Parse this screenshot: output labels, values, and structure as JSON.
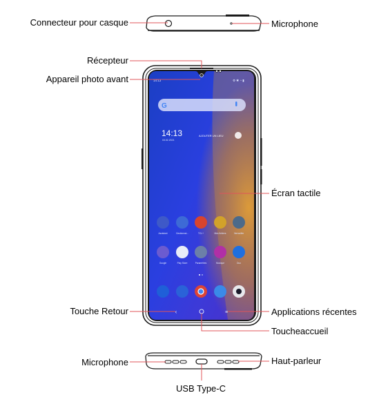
{
  "labels": {
    "headphone_jack": "Connecteur pour casque",
    "microphone_top": "Microphone",
    "receiver": "Récepteur",
    "front_camera": "Appareil photo avant",
    "touchscreen": "Écran tactile",
    "back_key": "Touche Retour",
    "recent_apps": "Applications récentes",
    "home_key": "Toucheaccueil",
    "microphone_bottom": "Microphone",
    "speaker": "Haut-parleur",
    "usb": "USB Type-C"
  },
  "screen": {
    "status_time": "14:13",
    "clock": "14:13",
    "date": "03.02.2021",
    "weather_prompt": "AJOUTER UN LIEU",
    "apps_row1": [
      "Assistant",
      "Gestionnai...",
      "TCL+",
      "Mes fichiers",
      "Verrouiller"
    ],
    "apps_row2": [
      "Google",
      "Play Store",
      "Paramètres",
      "Musique",
      "Duo"
    ],
    "dock": [
      "phone-icon",
      "messages-icon",
      "chrome-icon",
      "gallery-icon",
      "camera-icon"
    ]
  },
  "colors": {
    "leader_line": "#e0545a",
    "outline": "#1a1a1a"
  }
}
